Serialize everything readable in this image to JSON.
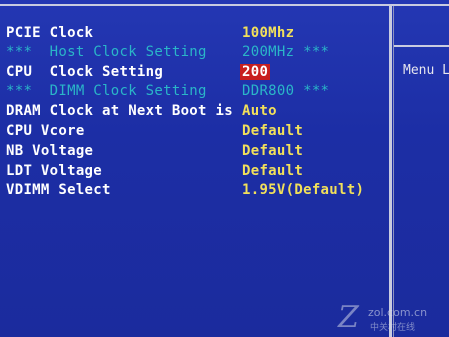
{
  "settings": [
    {
      "label": "PCIE Clock",
      "value": "100Mhz"
    },
    {
      "label": "***  Host Clock Setting",
      "value": "200MHz",
      "suffix": " ***"
    },
    {
      "label": "CPU  Clock Setting",
      "value": "200"
    },
    {
      "label": "***  DIMM Clock Setting",
      "value": "DDR800",
      "suffix": " ***"
    },
    {
      "label": "DRAM Clock at Next Boot is",
      "value": "Auto"
    },
    {
      "label": "CPU Vcore",
      "value": "Default"
    },
    {
      "label": "NB Voltage",
      "value": "Default"
    },
    {
      "label": "LDT Voltage",
      "value": "Default"
    },
    {
      "label": "VDIMM Select",
      "value": "1.95V(Default)"
    }
  ],
  "help": {
    "menu_label": "Menu L"
  },
  "watermark": {
    "mark": "Z",
    "site": "zol.com.cn",
    "sub": "中关村在线"
  },
  "colors": {
    "background": "#1d2fa6",
    "label": "#ffffff",
    "value": "#f2e05a",
    "info_row": "#2ab6c8",
    "selected_bg": "#c81f1f"
  }
}
